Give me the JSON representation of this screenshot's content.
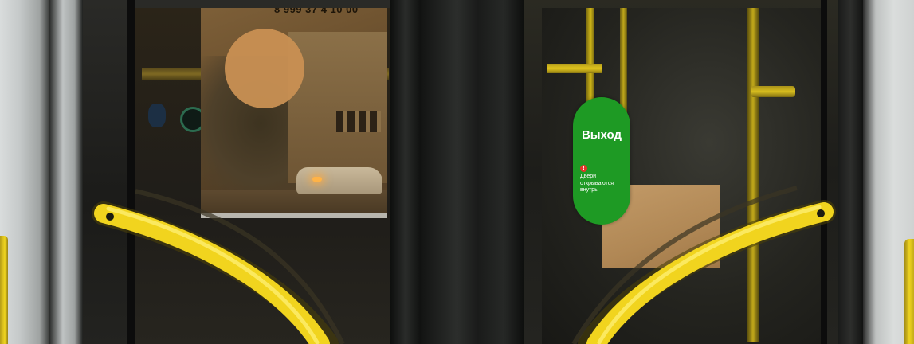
{
  "scene": {
    "description_kind": "photo of bus doors"
  },
  "poster": {
    "phone_fragment": "8 999 37 4 10 00"
  },
  "exit_sign": {
    "title": "Выход",
    "warning_icon": "exclamation-icon",
    "note": "Двери открываются внутрь",
    "color": "#1e9a24"
  },
  "colors": {
    "handrail_yellow": "#f2d51f",
    "frame_grey": "#c5c9c9"
  }
}
